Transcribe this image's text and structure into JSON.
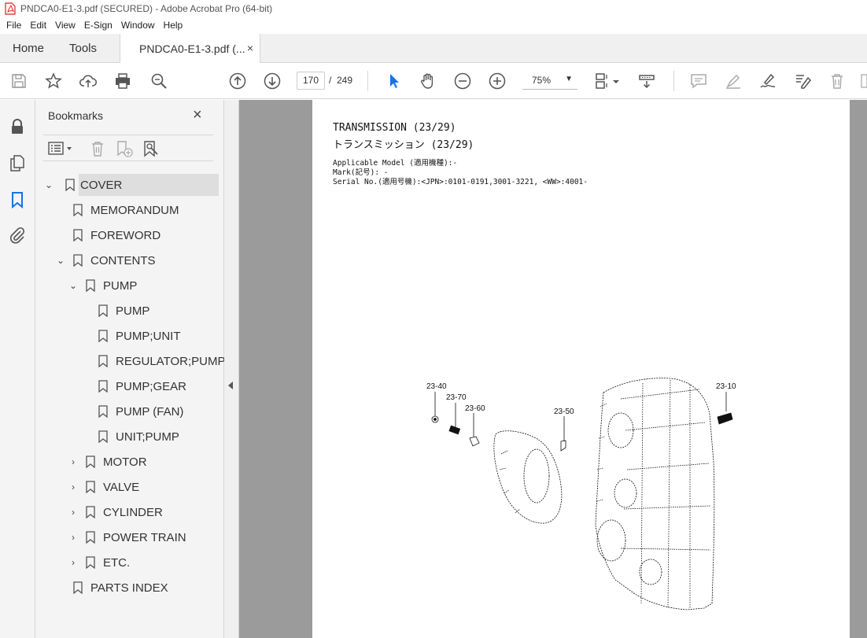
{
  "window": {
    "title": "PNDCA0-E1-3.pdf (SECURED) - Adobe Acrobat Pro (64-bit)"
  },
  "menu": {
    "items": [
      "File",
      "Edit",
      "View",
      "E-Sign",
      "Window",
      "Help"
    ]
  },
  "tabs": {
    "home": "Home",
    "tools": "Tools",
    "document": "PNDCA0-E1-3.pdf (...",
    "close": "×"
  },
  "toolbar": {
    "current_page": "170",
    "page_separator": "/",
    "total_pages": "249",
    "zoom": "75%"
  },
  "bookmarks": {
    "header": "Bookmarks",
    "close": "×",
    "items": [
      {
        "label": "COVER",
        "chevron": "⌄"
      },
      {
        "label": "MEMORANDUM",
        "chevron": ""
      },
      {
        "label": "FOREWORD",
        "chevron": ""
      },
      {
        "label": "CONTENTS",
        "chevron": "⌄"
      },
      {
        "label": "PUMP",
        "chevron": "⌄"
      },
      {
        "label": "PUMP",
        "chevron": ""
      },
      {
        "label": "PUMP;UNIT",
        "chevron": ""
      },
      {
        "label": "REGULATOR;PUMP",
        "chevron": ""
      },
      {
        "label": "PUMP;GEAR",
        "chevron": ""
      },
      {
        "label": "PUMP (FAN)",
        "chevron": ""
      },
      {
        "label": "UNIT;PUMP",
        "chevron": ""
      },
      {
        "label": "MOTOR",
        "chevron": "›"
      },
      {
        "label": "VALVE",
        "chevron": "›"
      },
      {
        "label": "CYLINDER",
        "chevron": "›"
      },
      {
        "label": "POWER TRAIN",
        "chevron": "›"
      },
      {
        "label": "ETC.",
        "chevron": "›"
      },
      {
        "label": "PARTS INDEX",
        "chevron": ""
      }
    ]
  },
  "document": {
    "title_en": "TRANSMISSION (23/29)",
    "title_jp": "トランスミッション (23/29)",
    "applicable_model": "Applicable Model (適用機種):-",
    "mark": "Mark(記号): -",
    "serial": "Serial No.(適用号機):<JPN>:0101-0191,3001-3221, <WW>:4001-",
    "part_labels": [
      "23-40",
      "23-70",
      "23-60",
      "23-50",
      "23-10"
    ]
  },
  "colors": {
    "accent": "#1473e6",
    "pdf_red": "#d4251c",
    "doc_background": "#9b9b9b"
  }
}
